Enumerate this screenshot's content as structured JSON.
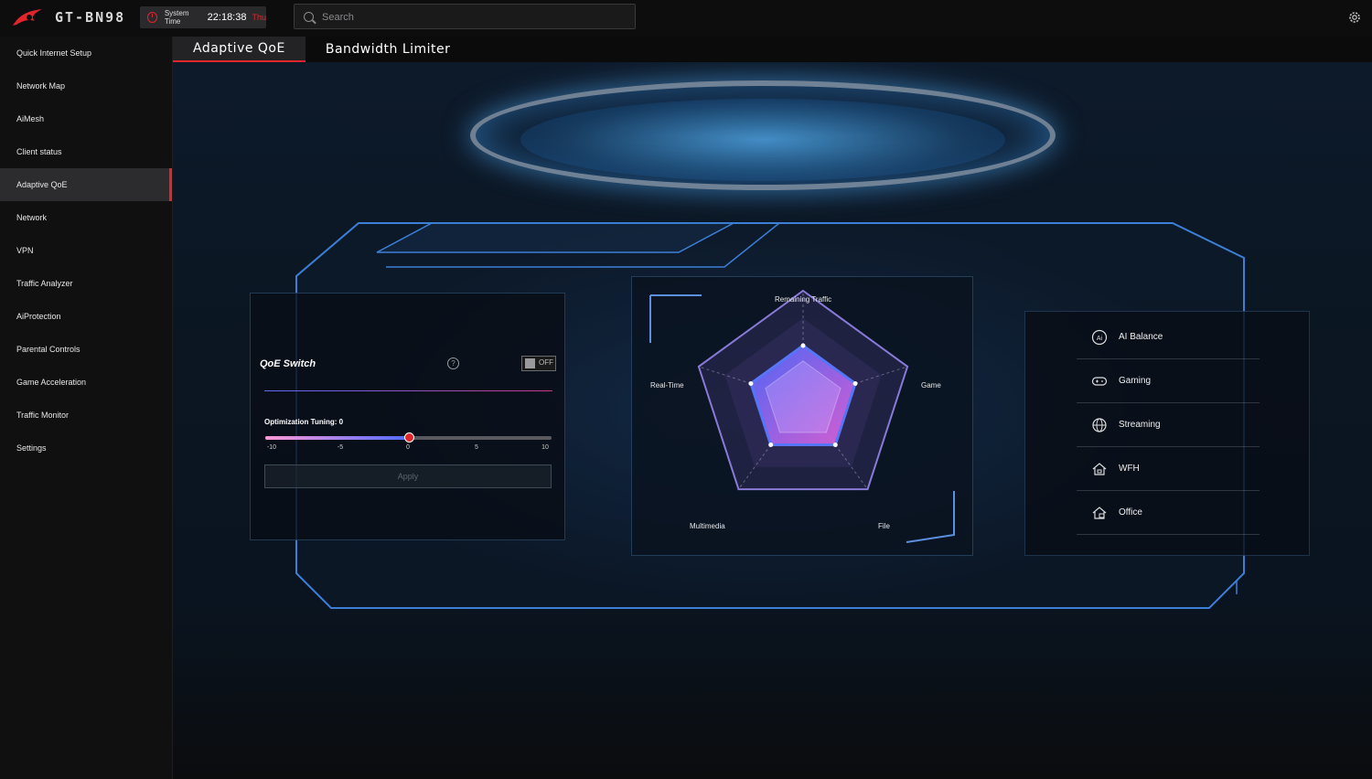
{
  "header": {
    "model": "GT-BN98",
    "system_time_label": "System Time",
    "time": "22:18:38",
    "day": "Thu",
    "search_placeholder": "Search"
  },
  "sidebar": {
    "items": [
      {
        "label": "Quick Internet Setup"
      },
      {
        "label": "Network Map"
      },
      {
        "label": "AiMesh"
      },
      {
        "label": "Client status"
      },
      {
        "label": "Adaptive QoE",
        "active": true
      },
      {
        "label": "Network"
      },
      {
        "label": "VPN"
      },
      {
        "label": "Traffic Analyzer"
      },
      {
        "label": "AiProtection"
      },
      {
        "label": "Parental Controls"
      },
      {
        "label": "Game Acceleration"
      },
      {
        "label": "Traffic Monitor"
      },
      {
        "label": "Settings"
      }
    ]
  },
  "tabs": [
    {
      "label": "Adaptive QoE",
      "active": true
    },
    {
      "label": "Bandwidth Limiter"
    }
  ],
  "qoe": {
    "title": "QoE Switch",
    "help_symbol": "?",
    "switch_state": "OFF",
    "tuning_label": "Optimization Tuning: 0",
    "slider": {
      "min": -10,
      "max": 10,
      "value": 0,
      "ticks": [
        "-10",
        "-5",
        "0",
        "5",
        "10"
      ]
    },
    "apply_label": "Apply"
  },
  "radar": {
    "axes": [
      "Remaining Traffic",
      "Game",
      "File",
      "Multimedia",
      "Real-Time"
    ],
    "values": [
      0.5,
      0.5,
      0.5,
      0.5,
      0.5
    ]
  },
  "modes": [
    {
      "label": "AI Balance",
      "icon": "ai-balance-icon"
    },
    {
      "label": "Gaming",
      "icon": "gamepad-icon"
    },
    {
      "label": "Streaming",
      "icon": "globe-icon"
    },
    {
      "label": "WFH",
      "icon": "home-work-icon"
    },
    {
      "label": "Office",
      "icon": "office-icon"
    }
  ],
  "colors": {
    "accent": "#e2242d",
    "sidebar_bg": "#101011",
    "active_item_bg": "#2c2c2e",
    "radar_fill": "#8a5cf0"
  }
}
